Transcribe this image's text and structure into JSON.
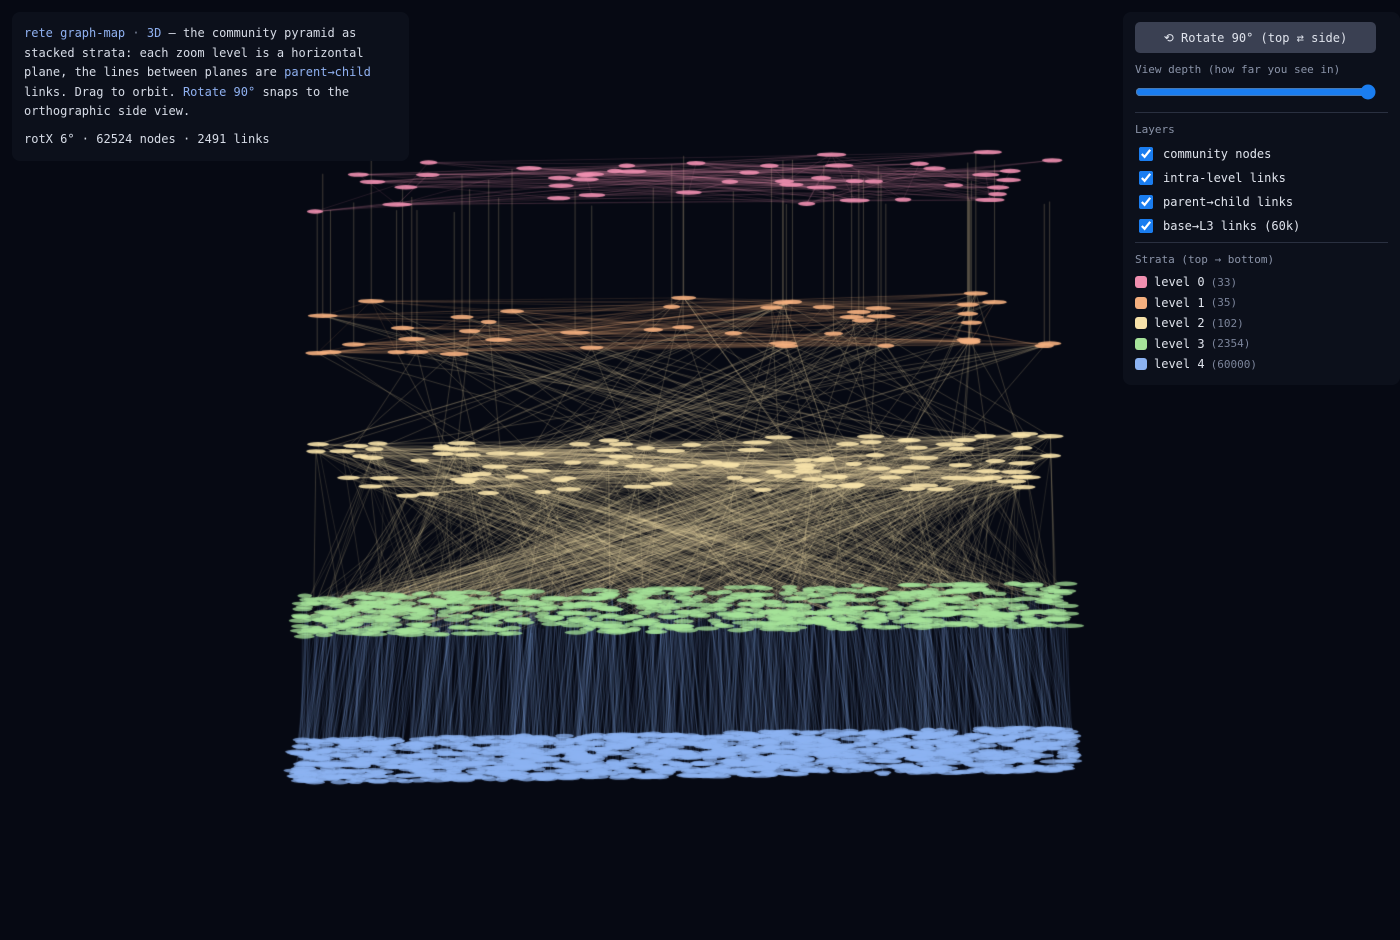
{
  "info": {
    "app_name": "rete graph-map",
    "separator": "·",
    "mode": "3D",
    "desc_part1": "— the community pyramid as stacked strata: each zoom level is a horizontal plane, the lines between planes are",
    "link_term": "parent→child",
    "desc_part2": "links. Drag to orbit.",
    "rotate_term": "Rotate 90°",
    "desc_part3": "snaps to the orthographic side view.",
    "stats": "rotX 6° · 62524 nodes · 2491 links"
  },
  "controls": {
    "rotate_button": "⟲ Rotate 90° (top ⇄ side)",
    "depth_label": "View depth (how far you see in)",
    "depth_value": 100,
    "layers_title": "Layers",
    "layers": [
      {
        "label": "community nodes",
        "checked": true
      },
      {
        "label": "intra-level links",
        "checked": true
      },
      {
        "label": "parent→child links",
        "checked": true
      },
      {
        "label": "base→L3 links (60k)",
        "checked": true
      }
    ],
    "strata_title": "Strata (top → bottom)",
    "strata": [
      {
        "label": "level 0",
        "count": "(33)",
        "color": "#f08fb0"
      },
      {
        "label": "level 1",
        "count": "(35)",
        "color": "#f5b07f"
      },
      {
        "label": "level 2",
        "count": "(102)",
        "color": "#f7e2aa"
      },
      {
        "label": "level 3",
        "count": "(2354)",
        "color": "#a6e39a"
      },
      {
        "label": "level 4",
        "count": "(60000)",
        "color": "#8cb3f2"
      }
    ]
  }
}
